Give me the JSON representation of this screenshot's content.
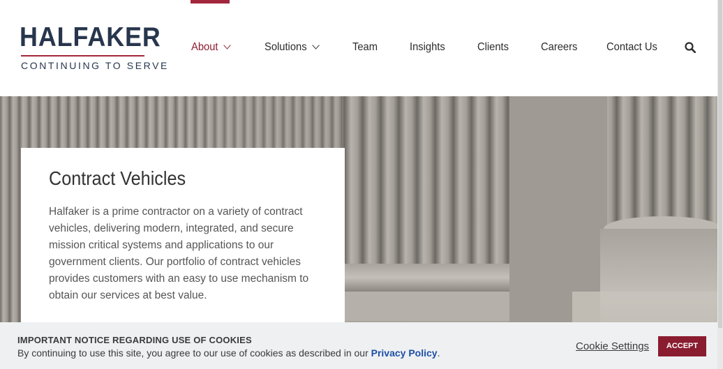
{
  "brand": {
    "name": "HALFAKER",
    "tagline": "CONTINUING TO SERVE"
  },
  "nav": {
    "items": [
      {
        "label": "About",
        "has_dropdown": true,
        "active": true
      },
      {
        "label": "Solutions",
        "has_dropdown": true,
        "active": false
      },
      {
        "label": "Team",
        "has_dropdown": false,
        "active": false
      },
      {
        "label": "Insights",
        "has_dropdown": false,
        "active": false
      },
      {
        "label": "Clients",
        "has_dropdown": false,
        "active": false
      },
      {
        "label": "Careers",
        "has_dropdown": false,
        "active": false
      },
      {
        "label": "Contact Us",
        "has_dropdown": false,
        "active": false
      }
    ],
    "search_icon": "search-icon"
  },
  "hero": {
    "title": "Contract Vehicles",
    "body": "Halfaker is a prime contractor on a variety of contract vehicles, delivering modern, integrated, and secure mission critical systems and applications to our government clients. Our portfolio of contract vehicles provides customers with an easy to use mechanism to obtain our services at best value."
  },
  "cookie_banner": {
    "title": "IMPORTANT NOTICE REGARDING USE OF COOKIES",
    "message_prefix": "By continuing to use this site, you agree to our use of cookies as described in our ",
    "link_text": "Privacy Policy",
    "message_suffix": ".",
    "settings_label": "Cookie Settings",
    "accept_label": "ACCEPT"
  },
  "colors": {
    "brand_navy": "#27364d",
    "brand_red": "#8a1c30",
    "link_blue": "#1e4fa8"
  }
}
